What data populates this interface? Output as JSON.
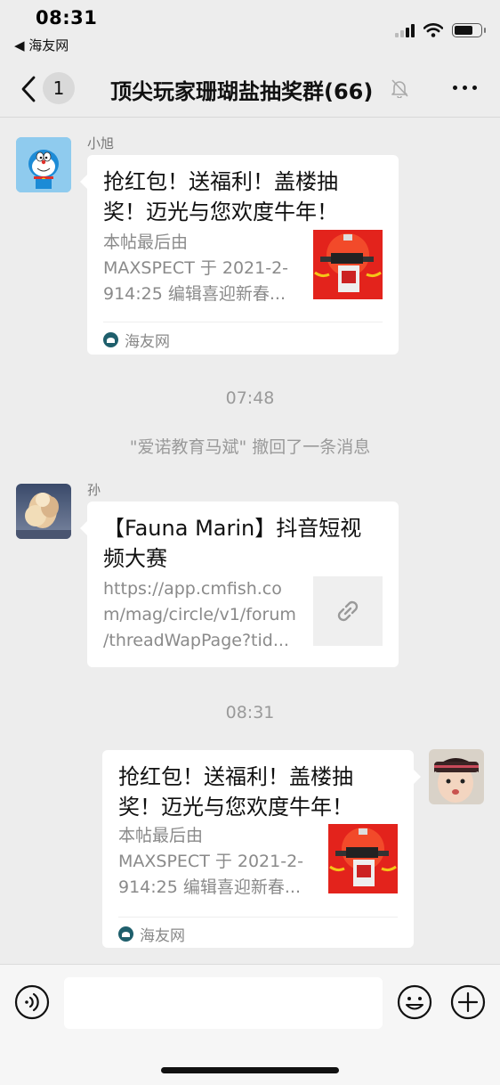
{
  "status_bar": {
    "time": "08:31",
    "back_app": "◀ 海友网",
    "signal_bars_active": 2,
    "signal_bars_total": 4,
    "battery_level": 0.7
  },
  "nav": {
    "unread_count": "1",
    "title": "顶尖玩家珊瑚盐抽奖群(66)",
    "muted_icon": "bell-slash-icon",
    "more_icon": "more-dots-icon"
  },
  "messages": [
    {
      "sender": "小旭",
      "avatar": "doraemon-avatar",
      "title_lines": [
        "抢红包！送福利！盖楼抽",
        "奖！迈光与您欢度牛年！"
      ],
      "desc_lines": [
        "本帖最后由",
        "MAXSPECT 于 2021-2-",
        "914:25 编辑喜迎新春..."
      ],
      "source": "海友网"
    },
    {
      "sender": "孙",
      "avatar": "clouds-avatar",
      "title_lines": [
        "【Fauna Marin】抖音短视",
        "频大赛"
      ],
      "desc_lines": [
        "https://app.cmfish.co",
        "m/mag/circle/v1/forum",
        "/threadWapPage?tid..."
      ]
    },
    {
      "sender": "",
      "avatar": "child-avatar",
      "title_lines": [
        "抢红包！送福利！盖楼抽",
        "奖！迈光与您欢度牛年！"
      ],
      "desc_lines": [
        "本帖最后由",
        "MAXSPECT 于 2021-2-",
        "914:25 编辑喜迎新春..."
      ],
      "source": "海友网"
    }
  ],
  "timestamps": [
    "07:48",
    "08:31"
  ],
  "system_message": "\"爱诺教育马斌\" 撤回了一条消息",
  "input": {
    "placeholder": "",
    "voice_icon": "voice-icon",
    "emoji_icon": "emoji-icon",
    "plus_icon": "plus-icon"
  },
  "colors": {
    "background": "#ededed",
    "bubble": "#ffffff",
    "thumb_red": "#e3231c",
    "source_icon": "#1f5f6c"
  }
}
